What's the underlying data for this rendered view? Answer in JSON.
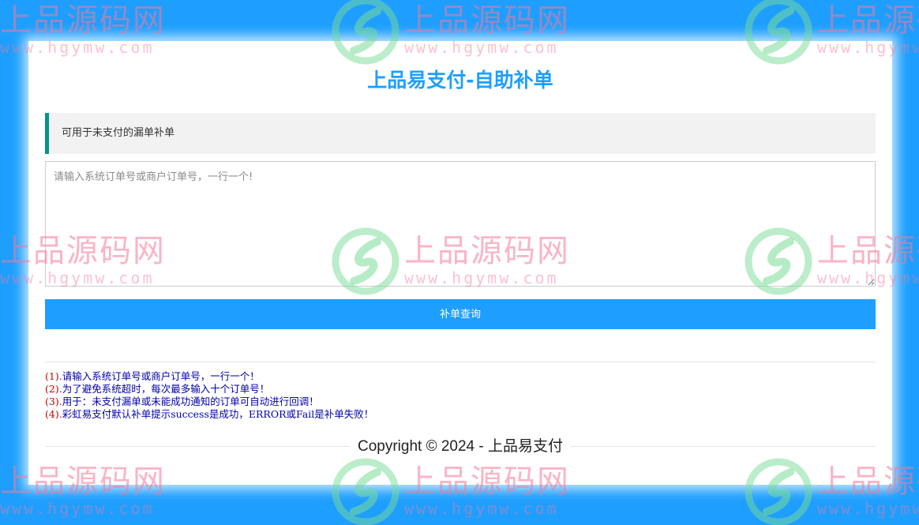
{
  "header": {
    "title": "上品易支付-自助补单"
  },
  "notice": {
    "text": "可用于未支付的漏单补单"
  },
  "form": {
    "order_input_placeholder": "请输入系统订单号或商户订单号，一行一个!",
    "order_input_value": "",
    "submit_label": "补单查询"
  },
  "tips": [
    {
      "num": "(1).",
      "text": "请输入系统订单号或商户订单号，一行一个！"
    },
    {
      "num": "(2).",
      "text": "为了避免系统超时，每次最多输入十个订单号！"
    },
    {
      "num": "(3).",
      "text": "用于：未支付漏单或未能成功通知的订单可自动进行回调！"
    },
    {
      "num": "(4).",
      "text": "彩虹易支付默认补单提示success是成功，ERROR或Fail是补单失败！"
    }
  ],
  "footer": {
    "copyright": "Copyright © 2024 - 上品易支付"
  },
  "watermark": {
    "brand": "上品源码网",
    "url": "www.hgymw.com",
    "logo_icon": "leaf-s-logo-icon"
  },
  "colors": {
    "background": "#1e9fff",
    "accent": "#1e9fff",
    "notice_border": "#009688",
    "tip_number": "#cc0000",
    "tip_text": "#0000aa"
  }
}
